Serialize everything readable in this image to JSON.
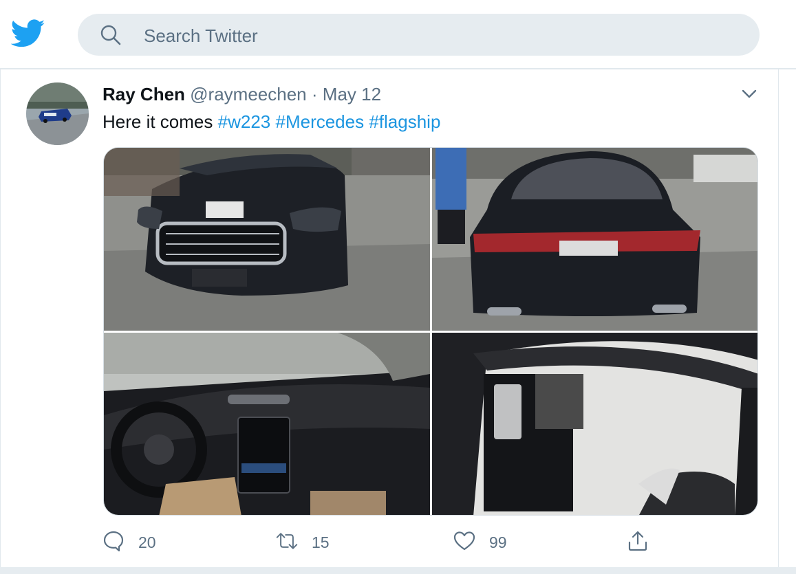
{
  "header": {
    "logo_icon": "twitter-bird-icon",
    "search_icon": "search-icon",
    "search_placeholder": "Search Twitter",
    "brand_color": "#1da1f2"
  },
  "tweet": {
    "author_name": "Ray Chen",
    "author_handle": "@raymeechen",
    "separator": "·",
    "date": "May 12",
    "text_plain": "Here it comes",
    "hashtags": [
      "#w223",
      "#Mercedes",
      "#flagship"
    ],
    "hashtag_color": "#1b95e0",
    "menu_icon": "chevron-down-icon",
    "photos": [
      {
        "subject": "front-of-black-car"
      },
      {
        "subject": "rear-of-black-car"
      },
      {
        "subject": "car-interior-dashboard"
      },
      {
        "subject": "car-door-interior"
      }
    ],
    "actions": {
      "replies": "20",
      "retweets": "15",
      "likes": "99",
      "reply_icon": "reply-icon",
      "retweet_icon": "retweet-icon",
      "like_icon": "heart-icon",
      "share_icon": "share-icon"
    }
  }
}
